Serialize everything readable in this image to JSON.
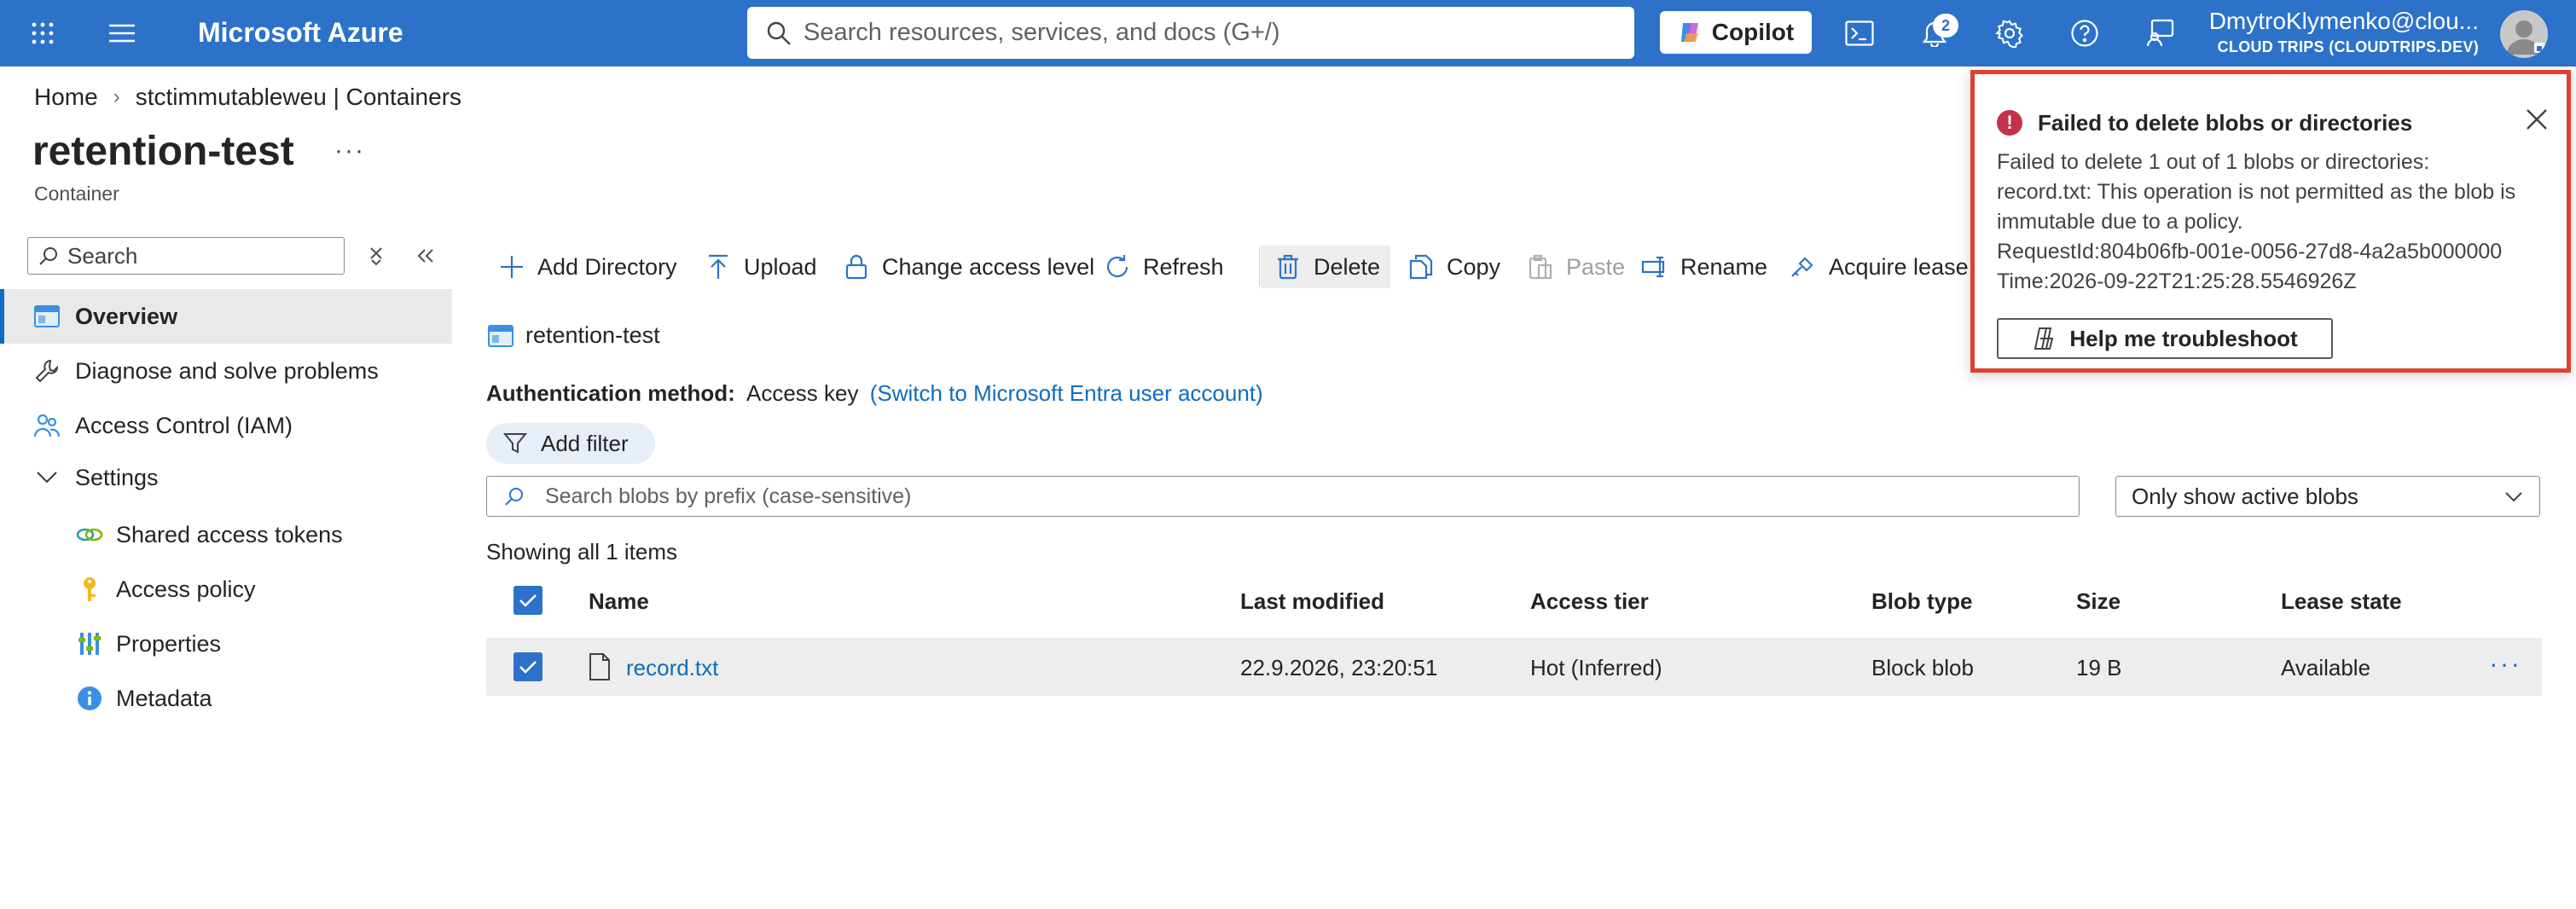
{
  "topbar": {
    "brand": "Microsoft Azure",
    "search_placeholder": "Search resources, services, and docs (G+/)",
    "copilot_label": "Copilot",
    "notifications_count": "2",
    "user_name": "DmytroKlymenko@clou...",
    "user_directory": "CLOUD TRIPS (CLOUDTRIPS.DEV)",
    "icons": [
      "apps-grid-icon",
      "hamburger-menu-icon",
      "search-icon",
      "copilot-icon",
      "cloud-shell-icon",
      "bell-icon",
      "gear-icon",
      "help-icon",
      "feedback-icon",
      "avatar-icon"
    ],
    "color": "#2d72c9"
  },
  "breadcrumb": {
    "items": [
      "Home",
      "stctimmutableweu | Containers"
    ]
  },
  "page": {
    "title": "retention-test",
    "more": "···",
    "subtitle": "Container"
  },
  "sidebar": {
    "search_placeholder": "Search",
    "items": [
      {
        "label": "Overview",
        "icon": "overview-icon",
        "active": true
      },
      {
        "label": "Diagnose and solve problems",
        "icon": "wrench-icon"
      },
      {
        "label": "Access Control (IAM)",
        "icon": "people-icon"
      },
      {
        "label": "Settings",
        "icon": "chevron-down-icon"
      },
      {
        "label": "Shared access tokens",
        "icon": "link-icon"
      },
      {
        "label": "Access policy",
        "icon": "key-icon"
      },
      {
        "label": "Properties",
        "icon": "properties-icon"
      },
      {
        "label": "Metadata",
        "icon": "info-icon"
      }
    ]
  },
  "toolbar": {
    "add_directory": "Add Directory",
    "upload": "Upload",
    "change_access_level": "Change access level",
    "refresh": "Refresh",
    "delete": "Delete",
    "copy": "Copy",
    "paste": "Paste",
    "rename": "Rename",
    "acquire_lease": "Acquire lease"
  },
  "content": {
    "container_path": "retention-test",
    "auth_label": "Authentication method:",
    "auth_value": "Access key",
    "auth_link": "(Switch to Microsoft Entra user account)",
    "add_filter": "Add filter",
    "blob_search_placeholder": "Search blobs by prefix (case-sensitive)",
    "blob_filter_selected": "Only show active blobs",
    "showing": "Showing all 1 items"
  },
  "table": {
    "columns": [
      "Name",
      "Last modified",
      "Access tier",
      "Blob type",
      "Size",
      "Lease state"
    ],
    "rows": [
      {
        "name": "record.txt",
        "last_modified": "22.9.2026, 23:20:51",
        "access_tier": "Hot (Inferred)",
        "blob_type": "Block blob",
        "size": "19 B",
        "lease_state": "Available",
        "more": "···"
      }
    ]
  },
  "notification": {
    "title": "Failed to delete blobs or directories",
    "line1": "Failed to delete 1 out of 1 blobs or directories:",
    "line2": "record.txt: This operation is not permitted as the blob is",
    "line3": "immutable due to a policy.",
    "line4": "RequestId:804b06fb-001e-0056-27d8-4a2a5b000000",
    "line5": "Time:2026-09-22T21:25:28.5546926Z",
    "help_button": "Help me troubleshoot",
    "border_color": "#e0402f",
    "error_color": "#c4314b"
  }
}
